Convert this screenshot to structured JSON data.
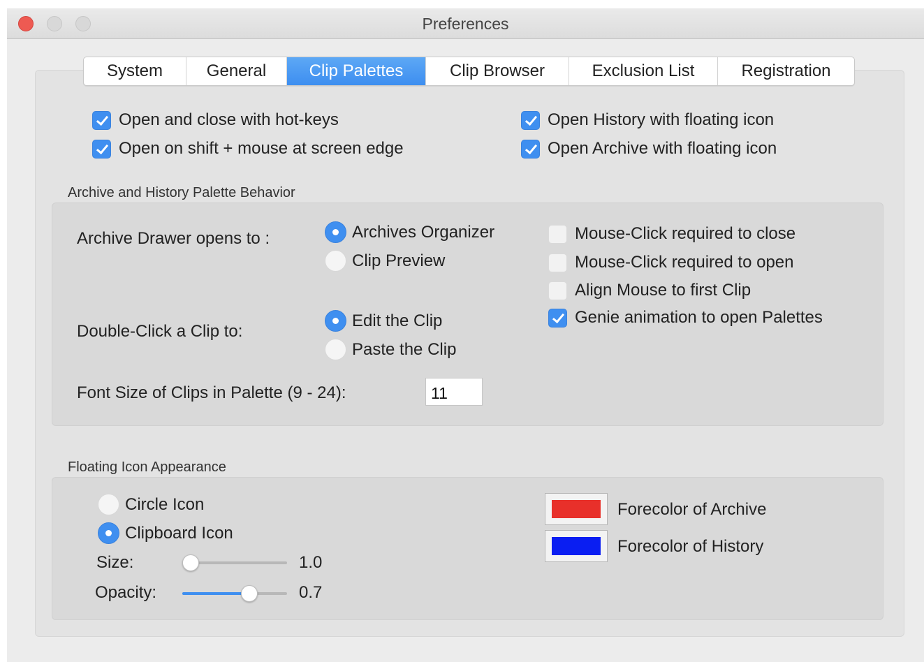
{
  "window": {
    "title": "Preferences"
  },
  "tabs": [
    {
      "label": "System",
      "active": false
    },
    {
      "label": "General",
      "active": false
    },
    {
      "label": "Clip Palettes",
      "active": true
    },
    {
      "label": "Clip Browser",
      "active": false
    },
    {
      "label": "Exclusion List",
      "active": false
    },
    {
      "label": "Registration",
      "active": false
    }
  ],
  "top_options": [
    {
      "label": "Open and close with hot-keys",
      "checked": true
    },
    {
      "label": "Open on shift + mouse at screen edge",
      "checked": true
    },
    {
      "label": "Open History with floating icon",
      "checked": true
    },
    {
      "label": "Open Archive with floating icon",
      "checked": true
    }
  ],
  "behavior": {
    "section_title": "Archive and History Palette Behavior",
    "archive_drawer_label": "Archive Drawer opens to :",
    "archive_drawer_options": [
      {
        "label": "Archives Organizer",
        "selected": true
      },
      {
        "label": "Clip Preview",
        "selected": false
      }
    ],
    "double_click_label": "Double-Click a Clip to:",
    "double_click_options": [
      {
        "label": "Edit the Clip",
        "selected": true
      },
      {
        "label": "Paste the Clip",
        "selected": false
      }
    ],
    "font_size_label": "Font Size of Clips in Palette (9 - 24):",
    "font_size_value": "11",
    "checkboxes": [
      {
        "label": "Mouse-Click required to close",
        "checked": false
      },
      {
        "label": "Mouse-Click required to open",
        "checked": false
      },
      {
        "label": "Align Mouse to first Clip",
        "checked": false
      },
      {
        "label": "Genie animation to open Palettes",
        "checked": true
      }
    ]
  },
  "floating": {
    "section_title": "Floating Icon Appearance",
    "icon_options": [
      {
        "label": "Circle Icon",
        "selected": false
      },
      {
        "label": "Clipboard Icon",
        "selected": true
      }
    ],
    "size": {
      "label": "Size:",
      "value": "1.0",
      "fraction": 0.0
    },
    "opacity": {
      "label": "Opacity:",
      "value": "0.7",
      "fraction": 0.67
    },
    "colors": [
      {
        "label": "Forecolor of Archive",
        "color": "#e8302a"
      },
      {
        "label": "Forecolor of History",
        "color": "#0a1ef2"
      }
    ]
  },
  "colors": {
    "accent": "#3f8ff0",
    "close_button": "#ee5a52"
  }
}
